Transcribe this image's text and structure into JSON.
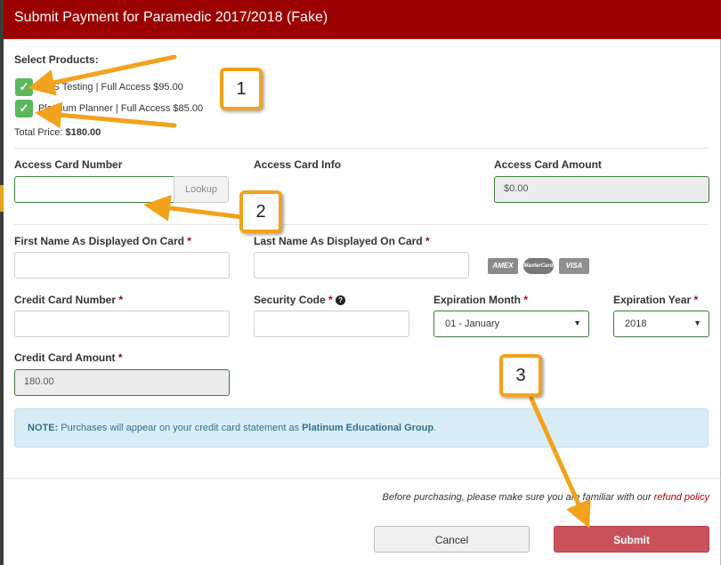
{
  "modal": {
    "title": "Submit Payment for Paramedic 2017/2018 (Fake)"
  },
  "products": {
    "heading": "Select Products:",
    "items": [
      {
        "label": "EMS Testing | Full Access $95.00",
        "checked": true
      },
      {
        "label": "Platinum Planner | Full Access $85.00",
        "checked": true
      }
    ],
    "total_label": "Total Price:",
    "total_value": "$180.00"
  },
  "access_card": {
    "number_label": "Access Card Number",
    "number_value": "",
    "lookup_label": "Lookup",
    "info_label": "Access Card Info",
    "amount_label": "Access Card Amount",
    "amount_value": "$0.00"
  },
  "billing": {
    "first_name_label": "First Name As Displayed On Card",
    "last_name_label": "Last Name As Displayed On Card",
    "cc_number_label": "Credit Card Number",
    "security_code_label": "Security Code",
    "exp_month_label": "Expiration Month",
    "exp_month_value": "01 - January",
    "exp_year_label": "Expiration Year",
    "exp_year_value": "2018",
    "cc_amount_label": "Credit Card Amount",
    "cc_amount_value": "180.00",
    "required_mark": "*",
    "help_glyph": "?",
    "card_logos": [
      "AMEX",
      "MasterCard",
      "VISA"
    ]
  },
  "note": {
    "prefix": "NOTE:",
    "text": "Purchases will appear on your credit card statement as",
    "company": "Platinum Educational Group",
    "suffix": "."
  },
  "footer": {
    "disclaimer": "Before purchasing, please make sure you are familiar with our",
    "refund_link": "refund policy",
    "cancel_label": "Cancel",
    "submit_label": "Submit"
  },
  "callouts": [
    "1",
    "2",
    "3"
  ],
  "colors": {
    "header": "#9b0000",
    "check_green": "#5cb85c",
    "submit": "#c9525a",
    "callout_orange": "#f2a21c",
    "note_bg": "#d9edf7"
  }
}
